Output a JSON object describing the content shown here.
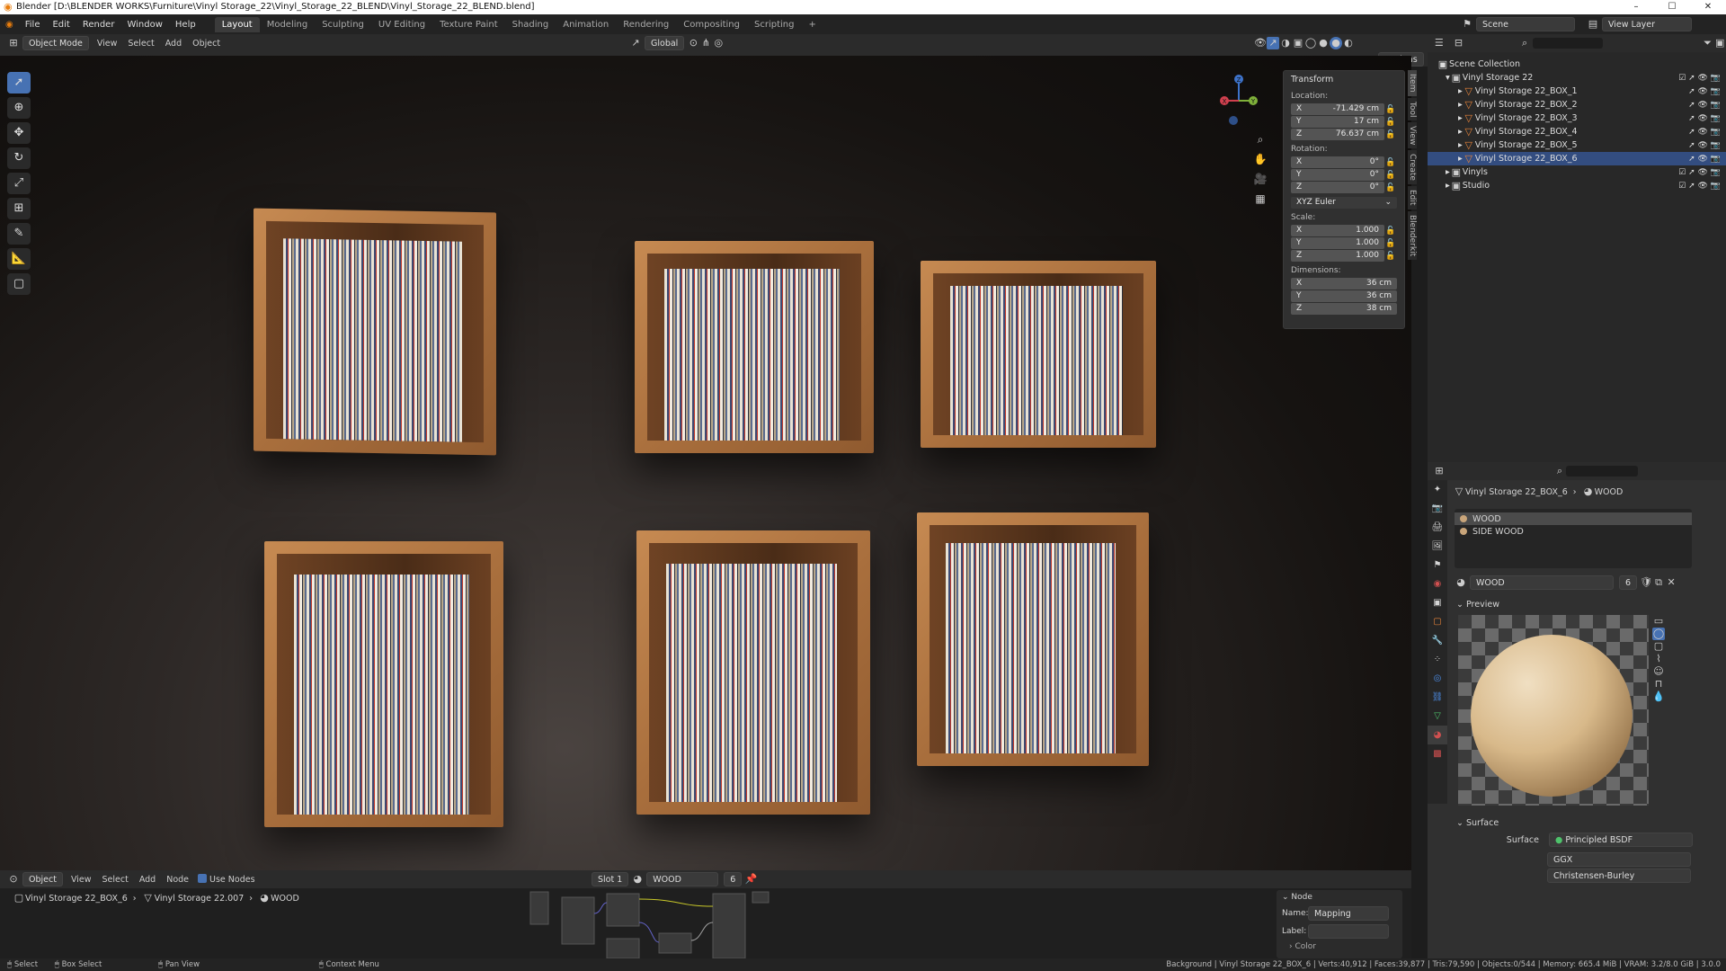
{
  "window": {
    "title": "Blender [D:\\BLENDER WORKS\\Furniture\\Vinyl Storage_22\\Vinyl_Storage_22_BLEND\\Vinyl_Storage_22_BLEND.blend]",
    "minimize": "–",
    "maximize": "☐",
    "close": "✕"
  },
  "menu": {
    "items": [
      "File",
      "Edit",
      "Render",
      "Window",
      "Help"
    ],
    "workspaces": [
      "Layout",
      "Modeling",
      "Sculpting",
      "UV Editing",
      "Texture Paint",
      "Shading",
      "Animation",
      "Rendering",
      "Compositing",
      "Scripting",
      "+"
    ],
    "scene": "Scene",
    "view_layer": "View Layer"
  },
  "viewport_header": {
    "mode": "Object Mode",
    "menus": [
      "View",
      "Select",
      "Add",
      "Object"
    ],
    "orientation": "Global",
    "options": "Options"
  },
  "transform": {
    "title": "Transform",
    "location_label": "Location:",
    "location": [
      {
        "axis": "X",
        "value": "-71.429 cm"
      },
      {
        "axis": "Y",
        "value": "17 cm"
      },
      {
        "axis": "Z",
        "value": "76.637 cm"
      }
    ],
    "rotation_label": "Rotation:",
    "rotation": [
      {
        "axis": "X",
        "value": "0°"
      },
      {
        "axis": "Y",
        "value": "0°"
      },
      {
        "axis": "Z",
        "value": "0°"
      }
    ],
    "rotation_mode": "XYZ Euler",
    "scale_label": "Scale:",
    "scale": [
      {
        "axis": "X",
        "value": "1.000"
      },
      {
        "axis": "Y",
        "value": "1.000"
      },
      {
        "axis": "Z",
        "value": "1.000"
      }
    ],
    "dimensions_label": "Dimensions:",
    "dimensions": [
      {
        "axis": "X",
        "value": "36 cm"
      },
      {
        "axis": "Y",
        "value": "36 cm"
      },
      {
        "axis": "Z",
        "value": "38 cm"
      }
    ]
  },
  "sidebar_tabs": [
    "Item",
    "Tool",
    "View",
    "Create",
    "Edit",
    "Blenderkit"
  ],
  "gizmo": {
    "x": "X",
    "y": "Y",
    "z": "Z"
  },
  "outliner": {
    "title": "Scene Collection",
    "rows": [
      {
        "label": "Vinyl Storage 22",
        "depth": 1
      },
      {
        "label": "Vinyl Storage 22_BOX_1",
        "depth": 2
      },
      {
        "label": "Vinyl Storage 22_BOX_2",
        "depth": 2
      },
      {
        "label": "Vinyl Storage 22_BOX_3",
        "depth": 2
      },
      {
        "label": "Vinyl Storage 22_BOX_4",
        "depth": 2
      },
      {
        "label": "Vinyl Storage 22_BOX_5",
        "depth": 2
      },
      {
        "label": "Vinyl Storage 22_BOX_6",
        "depth": 2
      },
      {
        "label": "Vinyls",
        "depth": 1
      },
      {
        "label": "Studio",
        "depth": 1
      }
    ]
  },
  "properties": {
    "breadcrumb_object": "Vinyl Storage 22_BOX_6",
    "breadcrumb_material": "WOOD",
    "slots": [
      "WOOD",
      "SIDE WOOD"
    ],
    "material_name": "WOOD",
    "users": "6",
    "preview_label": "Preview",
    "surface_label": "Surface",
    "surface_field_label": "Surface",
    "surface_value": "Principled BSDF",
    "distribution": "GGX",
    "subsurface": "Christensen-Burley"
  },
  "node_editor": {
    "type_label": "Object",
    "menus": [
      "View",
      "Select",
      "Add",
      "Node"
    ],
    "use_nodes": "Use Nodes",
    "slot": "Slot 1",
    "material": "WOOD",
    "users": "6",
    "breadcrumb": [
      "Vinyl Storage 22_BOX_6",
      "Vinyl Storage 22.007",
      "WOOD"
    ],
    "panel_title": "Node",
    "name_label": "Name:",
    "name_value": "Mapping",
    "label_label": "Label:",
    "label_value": "",
    "color_label": "Color"
  },
  "statusbar": {
    "select": "Select",
    "box_select": "Box Select",
    "pan_view": "Pan View",
    "context_menu": "Context Menu",
    "stats": "Background | Vinyl Storage 22_BOX_6 | Verts:40,912 | Faces:39,877 | Tris:79,590 | Objects:0/544 | Memory: 665.4 MiB | VRAM: 3.2/8.0 GiB | 3.0.0"
  }
}
